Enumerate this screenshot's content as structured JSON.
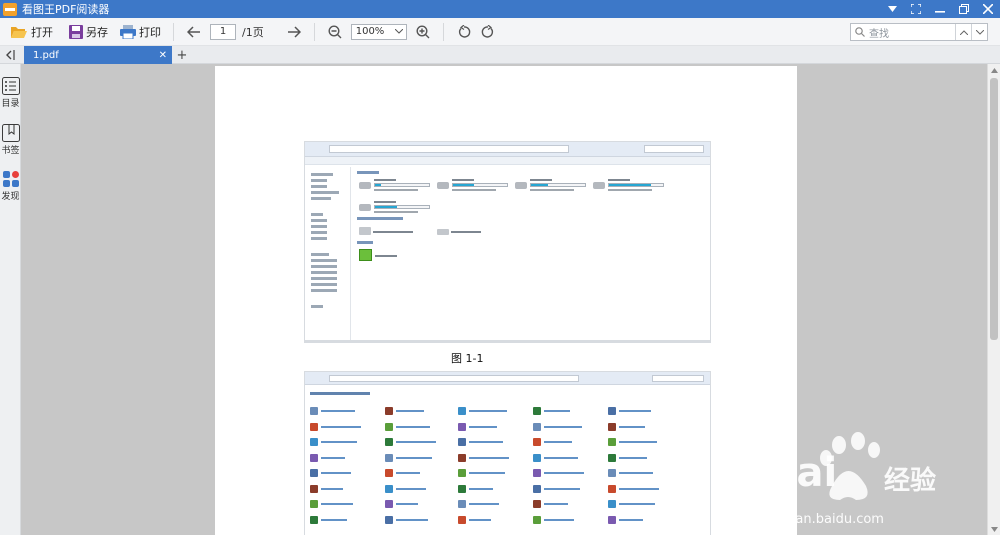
{
  "app": {
    "title": "看图王PDF阅读器"
  },
  "toolbar": {
    "open_label": "打开",
    "save_as_label": "另存",
    "print_label": "打印",
    "page_current": "1",
    "page_total": "/1页",
    "zoom_value": "100%",
    "search_placeholder": "查找"
  },
  "tabs": [
    {
      "label": "1.pdf",
      "active": true
    }
  ],
  "left_panel": {
    "items": [
      {
        "label": "目录",
        "icon": "list-icon"
      },
      {
        "label": "书签",
        "icon": "bookmark-icon"
      },
      {
        "label": "发现",
        "icon": "apps-icon"
      }
    ]
  },
  "document": {
    "figure_caption": "图 1-1"
  },
  "watermark": {
    "brand_text": "Bai",
    "brand_suffix": "经验",
    "url": "jingyan.baidu.com"
  },
  "colors": {
    "accent": "#3d78c8",
    "toolbar_bg": "#f4f5f7",
    "viewport_bg": "#c7c7c7",
    "drive_fill": "#27a6d2"
  }
}
